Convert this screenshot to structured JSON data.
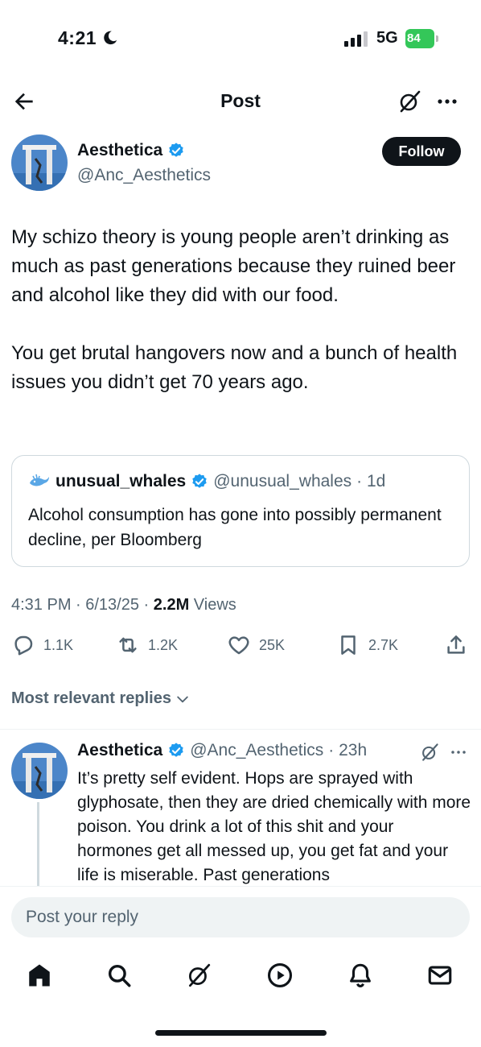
{
  "status_bar": {
    "time": "4:21",
    "network": "5G",
    "battery": "84"
  },
  "header": {
    "title": "Post"
  },
  "post": {
    "author_name": "Aesthetica",
    "author_handle": "@Anc_Aesthetics",
    "follow_label": "Follow",
    "text": "My schizo theory is young people aren’t drinking as much as past generations because they ruined beer and alcohol like they did with our food.\n\nYou get brutal hangovers now and a bunch of health issues you didn’t get 70 years ago.",
    "quote": {
      "author_name": "unusual_whales",
      "author_handle": "@unusual_whales",
      "age": "· 1d",
      "text": "Alcohol consumption has gone into possibly permanent decline, per Bloomberg"
    },
    "timestamp": "4:31 PM · 6/13/25 · ",
    "views_count": "2.2M",
    "views_label": " Views",
    "stats": {
      "replies": "1.1K",
      "reposts": "1.2K",
      "likes": "25K",
      "bookmarks": "2.7K"
    }
  },
  "replies_sort": "Most relevant replies",
  "reply": {
    "author_name": "Aesthetica",
    "author_handle": "@Anc_Aesthetics",
    "age": "· 23h",
    "text": "It’s pretty self evident. Hops are sprayed with glyphosate, then they are dried chemically with more poison. You drink a lot of this shit and your hormones get all messed up, you get fat and your life is miserable. Past generations"
  },
  "composer": {
    "placeholder": "Post your reply"
  },
  "colors": {
    "accent": "#1d9bf0",
    "text": "#0f1419",
    "secondary": "#536471",
    "battery": "#34c759"
  },
  "tabs": [
    "home-icon",
    "search-icon",
    "grok-icon",
    "video-icon",
    "notifications-icon",
    "messages-icon"
  ]
}
